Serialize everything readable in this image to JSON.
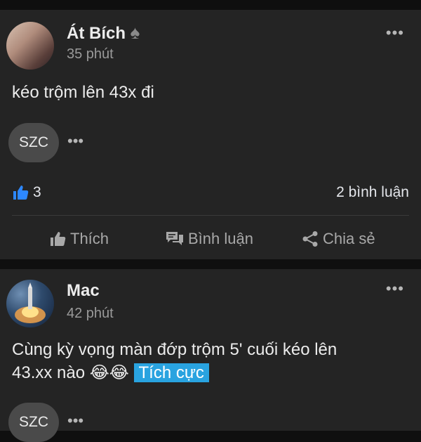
{
  "posts": [
    {
      "author": "Át Bích",
      "author_badge": "♠",
      "time": "35 phút",
      "content": "kéo trộm lên 43x đi",
      "tag_chip": "SZC",
      "like_count": "3",
      "comment_count": "2 bình luận",
      "actions": {
        "like": "Thích",
        "comment": "Bình luận",
        "share": "Chia sẻ"
      },
      "icons": {
        "like": "thumbs-up-icon",
        "comment": "comment-icon",
        "share": "share-icon",
        "more": "more-horizontal-icon"
      }
    },
    {
      "author": "Mac",
      "time": "42 phút",
      "content_line1": "Cùng kỳ vọng màn đớp trộm 5' cuối kéo lên",
      "content_line2": "43.xx nào",
      "emojis": "😂😂",
      "sentiment_tag": "Tích cực",
      "tag_chip": "SZC"
    }
  ],
  "colors": {
    "page_bg": "#0f0f0f",
    "card_bg": "#242424",
    "accent_blue": "#29a3e0",
    "like_blue": "#2d88ff"
  }
}
